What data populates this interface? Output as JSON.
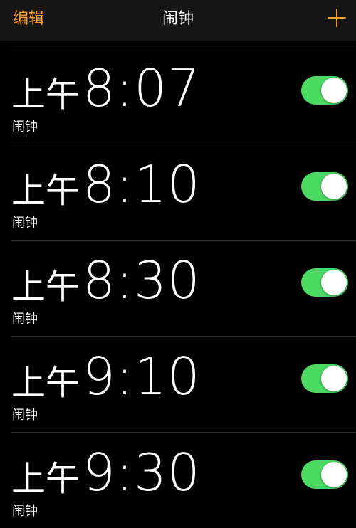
{
  "nav": {
    "edit_label": "编辑",
    "title": "闹钟",
    "add_icon": "plus-icon"
  },
  "colors": {
    "accent": "#f7a032",
    "toggle_on": "#4cd964",
    "background": "#000000"
  },
  "alarms": [
    {
      "ampm": "上午",
      "time": "8:07",
      "label": "闹钟",
      "enabled": true
    },
    {
      "ampm": "上午",
      "time": "8:10",
      "label": "闹钟",
      "enabled": true
    },
    {
      "ampm": "上午",
      "time": "8:30",
      "label": "闹钟",
      "enabled": true
    },
    {
      "ampm": "上午",
      "time": "9:10",
      "label": "闹钟",
      "enabled": true
    },
    {
      "ampm": "上午",
      "time": "9:30",
      "label": "闹钟",
      "enabled": true
    }
  ]
}
